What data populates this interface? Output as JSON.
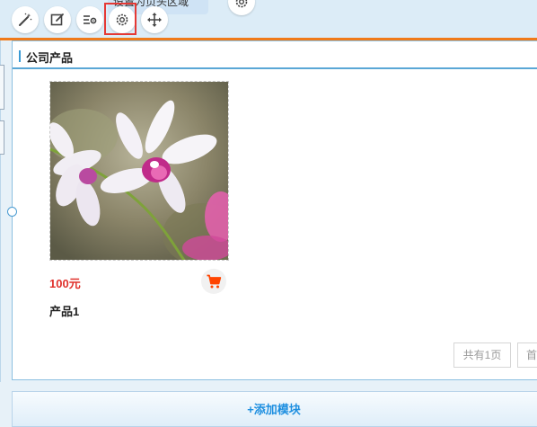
{
  "toolbar": {
    "tooltip_text": "设置为页头区域",
    "tools": [
      {
        "icon": "magic-wand-icon"
      },
      {
        "icon": "edit-icon"
      },
      {
        "icon": "list-settings-icon"
      },
      {
        "icon": "gear-icon"
      },
      {
        "icon": "move-icon"
      }
    ]
  },
  "panel": {
    "title": "公司产品"
  },
  "product": {
    "price": "100元",
    "name": "产品1",
    "image": "orchid-photo"
  },
  "pagination": {
    "total": "共有1页",
    "first": "首页"
  },
  "add_module": {
    "label": "+添加模块"
  },
  "colors": {
    "accent_orange": "#f07a1a",
    "price_red": "#e0312c",
    "link_blue": "#1e8fe0",
    "cart_red": "#ff4400"
  }
}
